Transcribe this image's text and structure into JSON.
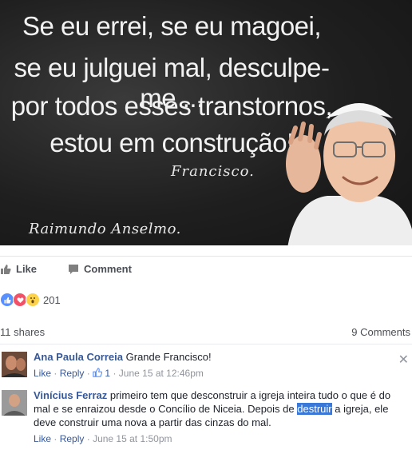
{
  "image": {
    "quote_lines": [
      "Se eu errei, se eu magoei,",
      "se eu julguei mal, desculpe-me ...",
      "por todos esses transtornos,",
      "estou em construção!"
    ],
    "signature": "Francisco.",
    "credit": "Raimundo Anselmo."
  },
  "actions": {
    "like_label": "Like",
    "comment_label": "Comment"
  },
  "reactions": {
    "icons": [
      "like-icon",
      "love-icon",
      "wow-icon"
    ],
    "count": "201"
  },
  "stats": {
    "shares": "11 shares",
    "comments": "9 Comments"
  },
  "comments": [
    {
      "author": "Ana Paula Correia",
      "text": "Grande Francisco!",
      "like": "Like",
      "reply": "Reply",
      "likes": "1",
      "time": "June 15 at 12:46pm"
    },
    {
      "author": "Vinícius Ferraz",
      "text_before": "primeiro tem que desconstruir a igreja inteira tudo o que é do mal e se enraizou desde o Concílio de Niceia. Depois de ",
      "text_highlight": "destruir",
      "text_after": " a igreja, ele deve construir uma nova a partir das cinzas do mal.",
      "like": "Like",
      "reply": "Reply",
      "time": "June 15 at 1:50pm"
    }
  ],
  "colors": {
    "link": "#365899",
    "meta": "#90949c",
    "highlight": "#3b79d9"
  }
}
